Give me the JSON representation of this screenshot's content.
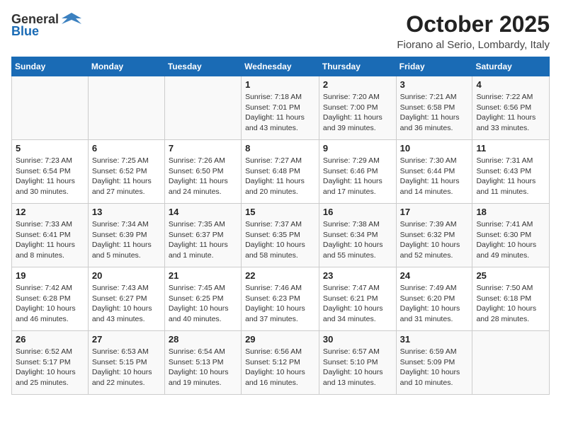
{
  "logo": {
    "general": "General",
    "blue": "Blue"
  },
  "title": "October 2025",
  "location": "Fiorano al Serio, Lombardy, Italy",
  "days_of_week": [
    "Sunday",
    "Monday",
    "Tuesday",
    "Wednesday",
    "Thursday",
    "Friday",
    "Saturday"
  ],
  "weeks": [
    [
      {
        "day": "",
        "info": ""
      },
      {
        "day": "",
        "info": ""
      },
      {
        "day": "",
        "info": ""
      },
      {
        "day": "1",
        "info": "Sunrise: 7:18 AM\nSunset: 7:01 PM\nDaylight: 11 hours and 43 minutes."
      },
      {
        "day": "2",
        "info": "Sunrise: 7:20 AM\nSunset: 7:00 PM\nDaylight: 11 hours and 39 minutes."
      },
      {
        "day": "3",
        "info": "Sunrise: 7:21 AM\nSunset: 6:58 PM\nDaylight: 11 hours and 36 minutes."
      },
      {
        "day": "4",
        "info": "Sunrise: 7:22 AM\nSunset: 6:56 PM\nDaylight: 11 hours and 33 minutes."
      }
    ],
    [
      {
        "day": "5",
        "info": "Sunrise: 7:23 AM\nSunset: 6:54 PM\nDaylight: 11 hours and 30 minutes."
      },
      {
        "day": "6",
        "info": "Sunrise: 7:25 AM\nSunset: 6:52 PM\nDaylight: 11 hours and 27 minutes."
      },
      {
        "day": "7",
        "info": "Sunrise: 7:26 AM\nSunset: 6:50 PM\nDaylight: 11 hours and 24 minutes."
      },
      {
        "day": "8",
        "info": "Sunrise: 7:27 AM\nSunset: 6:48 PM\nDaylight: 11 hours and 20 minutes."
      },
      {
        "day": "9",
        "info": "Sunrise: 7:29 AM\nSunset: 6:46 PM\nDaylight: 11 hours and 17 minutes."
      },
      {
        "day": "10",
        "info": "Sunrise: 7:30 AM\nSunset: 6:44 PM\nDaylight: 11 hours and 14 minutes."
      },
      {
        "day": "11",
        "info": "Sunrise: 7:31 AM\nSunset: 6:43 PM\nDaylight: 11 hours and 11 minutes."
      }
    ],
    [
      {
        "day": "12",
        "info": "Sunrise: 7:33 AM\nSunset: 6:41 PM\nDaylight: 11 hours and 8 minutes."
      },
      {
        "day": "13",
        "info": "Sunrise: 7:34 AM\nSunset: 6:39 PM\nDaylight: 11 hours and 5 minutes."
      },
      {
        "day": "14",
        "info": "Sunrise: 7:35 AM\nSunset: 6:37 PM\nDaylight: 11 hours and 1 minute."
      },
      {
        "day": "15",
        "info": "Sunrise: 7:37 AM\nSunset: 6:35 PM\nDaylight: 10 hours and 58 minutes."
      },
      {
        "day": "16",
        "info": "Sunrise: 7:38 AM\nSunset: 6:34 PM\nDaylight: 10 hours and 55 minutes."
      },
      {
        "day": "17",
        "info": "Sunrise: 7:39 AM\nSunset: 6:32 PM\nDaylight: 10 hours and 52 minutes."
      },
      {
        "day": "18",
        "info": "Sunrise: 7:41 AM\nSunset: 6:30 PM\nDaylight: 10 hours and 49 minutes."
      }
    ],
    [
      {
        "day": "19",
        "info": "Sunrise: 7:42 AM\nSunset: 6:28 PM\nDaylight: 10 hours and 46 minutes."
      },
      {
        "day": "20",
        "info": "Sunrise: 7:43 AM\nSunset: 6:27 PM\nDaylight: 10 hours and 43 minutes."
      },
      {
        "day": "21",
        "info": "Sunrise: 7:45 AM\nSunset: 6:25 PM\nDaylight: 10 hours and 40 minutes."
      },
      {
        "day": "22",
        "info": "Sunrise: 7:46 AM\nSunset: 6:23 PM\nDaylight: 10 hours and 37 minutes."
      },
      {
        "day": "23",
        "info": "Sunrise: 7:47 AM\nSunset: 6:21 PM\nDaylight: 10 hours and 34 minutes."
      },
      {
        "day": "24",
        "info": "Sunrise: 7:49 AM\nSunset: 6:20 PM\nDaylight: 10 hours and 31 minutes."
      },
      {
        "day": "25",
        "info": "Sunrise: 7:50 AM\nSunset: 6:18 PM\nDaylight: 10 hours and 28 minutes."
      }
    ],
    [
      {
        "day": "26",
        "info": "Sunrise: 6:52 AM\nSunset: 5:17 PM\nDaylight: 10 hours and 25 minutes."
      },
      {
        "day": "27",
        "info": "Sunrise: 6:53 AM\nSunset: 5:15 PM\nDaylight: 10 hours and 22 minutes."
      },
      {
        "day": "28",
        "info": "Sunrise: 6:54 AM\nSunset: 5:13 PM\nDaylight: 10 hours and 19 minutes."
      },
      {
        "day": "29",
        "info": "Sunrise: 6:56 AM\nSunset: 5:12 PM\nDaylight: 10 hours and 16 minutes."
      },
      {
        "day": "30",
        "info": "Sunrise: 6:57 AM\nSunset: 5:10 PM\nDaylight: 10 hours and 13 minutes."
      },
      {
        "day": "31",
        "info": "Sunrise: 6:59 AM\nSunset: 5:09 PM\nDaylight: 10 hours and 10 minutes."
      },
      {
        "day": "",
        "info": ""
      }
    ]
  ]
}
